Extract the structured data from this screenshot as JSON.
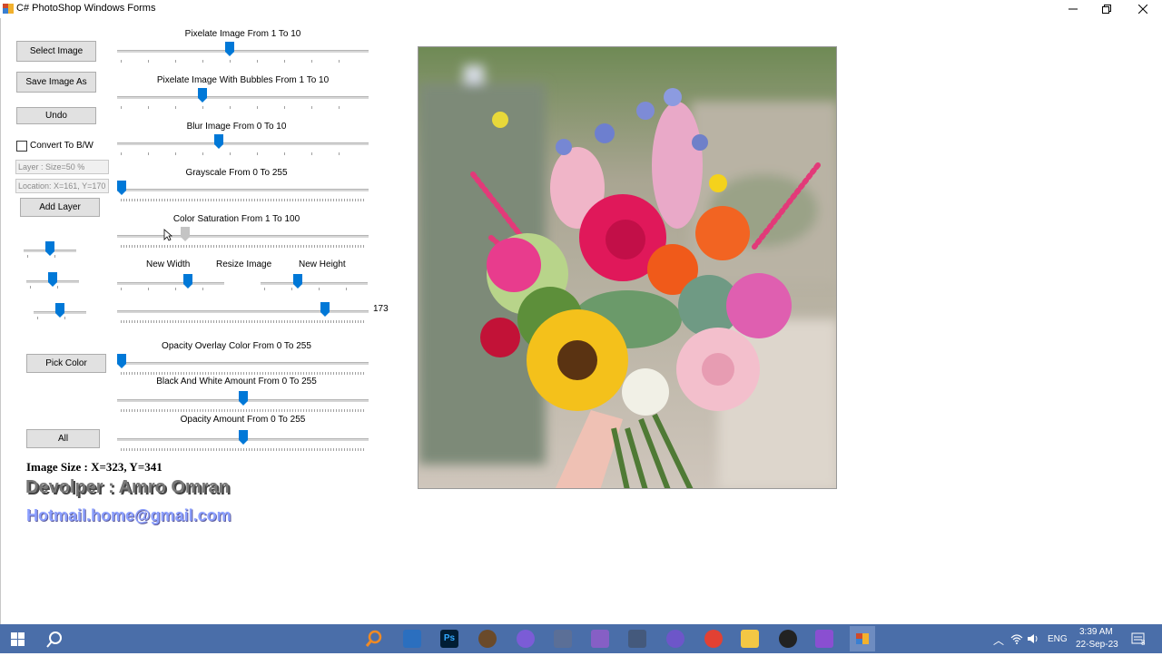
{
  "window": {
    "title": "C# PhotoShop Windows Forms"
  },
  "buttons": {
    "select_image": "Select Image",
    "save_image_as": "Save Image As",
    "undo": "Undo",
    "add_layer": "Add Layer",
    "pick_color": "Pick Color",
    "all": "All"
  },
  "checkbox": {
    "label": "Convert To B/W",
    "checked": false
  },
  "fields": {
    "layer_size": "Layer : Size=50 %",
    "location": "Location: X=161, Y=170"
  },
  "sliders": [
    {
      "label": "Pixelate Image From 1 To 10",
      "min": 1,
      "max": 10,
      "value": 5
    },
    {
      "label": "Pixelate Image With Bubbles From 1 To 10",
      "min": 1,
      "max": 10,
      "value": 4
    },
    {
      "label": "Blur Image From 0 To 10",
      "min": 0,
      "max": 10,
      "value": 4
    },
    {
      "label": "Grayscale From 0 To 255",
      "min": 0,
      "max": 255,
      "value": 0
    },
    {
      "label": "Color Saturation From 1 To 100",
      "min": 1,
      "max": 100,
      "value": 27,
      "disabled": true
    },
    {
      "label": "Opacity Overlay Color From 0 To 255",
      "min": 0,
      "max": 255,
      "value": 0
    },
    {
      "label": "Black And White Amount From 0 To 255",
      "min": 0,
      "max": 255,
      "value": 128
    },
    {
      "label": "Opacity Amount From 0 To 255",
      "min": 0,
      "max": 255,
      "value": 128
    }
  ],
  "resize": {
    "title": "Resize Image",
    "width_label": "New Width",
    "height_label": "New Height",
    "width_level": 0.68,
    "height_level": 0.33,
    "size_level": 0.84,
    "size_value": "173"
  },
  "small_sliders": [
    0.5,
    0.5,
    0.5
  ],
  "info": {
    "image_size": "Image Size : X=323, Y=341",
    "developer": "Devolper : Amro Omran",
    "email": "Hotmail.home@gmail.com"
  },
  "taskbar": {
    "time": "3:39 AM",
    "date": "22-Sep-23",
    "lang": "ENG",
    "notifications": "8"
  },
  "colors": {
    "accent": "#0078d7",
    "taskbar": "#4a6ea9",
    "email": "#8da0ff"
  }
}
